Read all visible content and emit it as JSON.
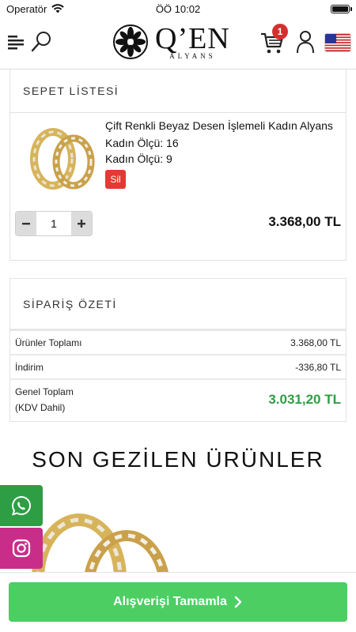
{
  "status_bar": {
    "carrier": "Operatör",
    "time": "ÖÖ 10:02"
  },
  "header": {
    "logo_text": "Q’EN",
    "logo_sub": "ALYANS",
    "cart_count": "1"
  },
  "cart": {
    "title": "SEPET LİSTESİ",
    "item": {
      "name": "Çift Renkli Beyaz Desen İşlemeli Kadın Alyans",
      "option1": "Kadın Ölçü: 16",
      "option2": "Kadın Ölçü: 9",
      "delete_label": "Sil",
      "quantity": "1",
      "price": "3.368,00 TL"
    }
  },
  "summary": {
    "title": "SİPARİŞ ÖZETİ",
    "rows": [
      {
        "label": "Ürünler Toplamı",
        "value": "3.368,00 TL"
      },
      {
        "label": "İndirim",
        "value": "-336,80 TL"
      }
    ],
    "total_label": "Genel Toplam",
    "total_note": "(KDV Dahil)",
    "total_value": "3.031,20 TL"
  },
  "recent": {
    "title": "SON GEZİLEN ÜRÜNLER"
  },
  "checkout": {
    "label": "Alışverişi Tamamla"
  },
  "colors": {
    "accent_green": "#4cce63",
    "price_green": "#2e9e45",
    "badge_red": "#d32f2f",
    "delete_red": "#e53935",
    "whatsapp": "#2e9e45",
    "instagram": "#c92d8a"
  }
}
